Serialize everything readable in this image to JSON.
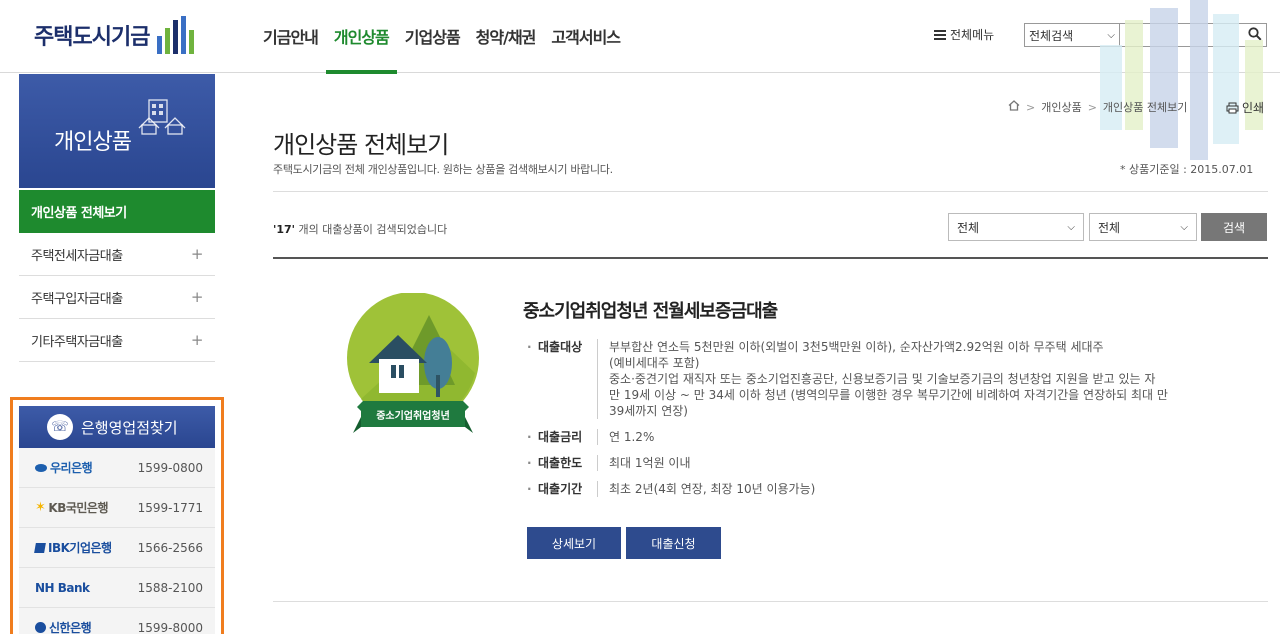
{
  "header": {
    "logo_text": "주택도시기금",
    "nav": [
      "기금안내",
      "개인상품",
      "기업상품",
      "청약/채권",
      "고객서비스"
    ],
    "active_nav": "개인상품",
    "all_menu": "전체메뉴",
    "search_scope": "전체검색",
    "search_value": ""
  },
  "sidebar": {
    "title": "개인상품",
    "items": [
      {
        "label": "개인상품 전체보기",
        "plus": ""
      },
      {
        "label": "주택전세자금대출",
        "plus": "+"
      },
      {
        "label": "주택구입자금대출",
        "plus": "+"
      },
      {
        "label": "기타주택자금대출",
        "plus": "+"
      }
    ]
  },
  "bank_finder": {
    "title": "은행영업점찾기",
    "banks": [
      {
        "name": "우리은행",
        "phone": "1599-0800",
        "color": "#1d5fae"
      },
      {
        "name": "KB국민은행",
        "phone": "1599-1771",
        "color": "#5e5a52"
      },
      {
        "name": "IBK기업은행",
        "phone": "1566-2566",
        "color": "#1a4e9e"
      },
      {
        "name": "NH Bank",
        "phone": "1588-2100",
        "color": "#1a4e9e"
      },
      {
        "name": "신한은행",
        "phone": "1599-8000",
        "color": "#1a4e9e"
      }
    ]
  },
  "breadcrumb": [
    "개인상품",
    "개인상품 전체보기"
  ],
  "print_label": "인쇄",
  "page": {
    "title": "개인상품 전체보기",
    "description": "주택도시기금의 전체 개인상품입니다. 원하는 상품을 검색해보시기 바랍니다.",
    "base_date": "* 상품기준일 : 2015.07.01",
    "count": "'17'",
    "count_suffix": " 개의 대출상품이 검색되었습니다",
    "filter1": "전체",
    "filter2": "전체",
    "search_button": "검색"
  },
  "product": {
    "badge": "중소기업취업청년",
    "title": "중소기업취업청년 전월세보증금대출",
    "info": [
      {
        "label": "대출대상",
        "lines": [
          "부부합산 연소득 5천만원 이하(외벌이 3천5백만원 이하), 순자산가액2.92억원 이하 무주택 세대주",
          "(예비세대주 포함)",
          "중소·중견기업 재직자 또는 중소기업진흥공단, 신용보증기금 및 기술보증기금의 청년창업 지원을 받고 있는 자",
          "만 19세 이상 ~ 만 34세 이하 청년 (병역의무를 이행한 경우 복무기간에 비례하여 자격기간을 연장하되 최대 만",
          "39세까지 연장)"
        ]
      },
      {
        "label": "대출금리",
        "lines": [
          "연 1.2%"
        ]
      },
      {
        "label": "대출한도",
        "lines": [
          "최대 1억원 이내"
        ]
      },
      {
        "label": "대출기간",
        "lines": [
          "최초 2년(4회 연장, 최장 10년 이용가능)"
        ]
      }
    ],
    "detail_button": "상세보기",
    "apply_button": "대출신청"
  }
}
